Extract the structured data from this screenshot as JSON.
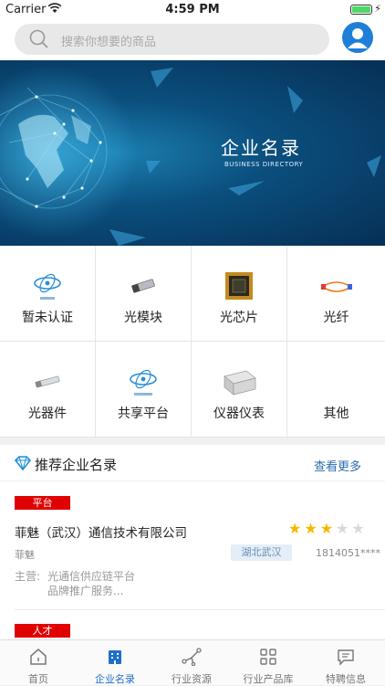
{
  "status_bar": {
    "carrier": "Carrier",
    "time": "4:59 PM"
  },
  "search": {
    "placeholder": "搜索你想要的商品"
  },
  "banner": {
    "title": "企业名录",
    "subtitle": "BUSINESS DIRECTORY"
  },
  "categories": [
    {
      "label": "暂未认证",
      "icon": "logo-icon"
    },
    {
      "label": "光模块",
      "icon": "optical-module-icon"
    },
    {
      "label": "光芯片",
      "icon": "chip-icon"
    },
    {
      "label": "光纤",
      "icon": "fiber-icon"
    },
    {
      "label": "光器件",
      "icon": "optical-device-icon"
    },
    {
      "label": "共享平台",
      "icon": "platform-logo-icon"
    },
    {
      "label": "仪器仪表",
      "icon": "instrument-icon"
    },
    {
      "label": "其他",
      "icon": "none"
    }
  ],
  "recommend": {
    "title": "推荐企业名录",
    "more": "查看更多",
    "items": [
      {
        "tag": "平台",
        "company": "菲魅（武汉）通信技术有限公司",
        "rating": 3,
        "rating_max": 5,
        "short_name": "菲魅",
        "region": "湖北武汉",
        "phone": "1814051****",
        "business_label": "主营:",
        "business_value": "光通信供应链平台\n品牌推广服务..."
      },
      {
        "tag": "人才"
      }
    ]
  },
  "tabs": [
    {
      "label": "首页",
      "icon": "home-icon"
    },
    {
      "label": "企业名录",
      "icon": "directory-icon",
      "active": true
    },
    {
      "label": "行业资源",
      "icon": "resource-icon"
    },
    {
      "label": "行业产品库",
      "icon": "product-library-icon"
    },
    {
      "label": "特聘信息",
      "icon": "message-icon"
    }
  ],
  "colors": {
    "accent": "#1f6fc8",
    "tag_red": "#e00000",
    "star": "#f5b800"
  }
}
